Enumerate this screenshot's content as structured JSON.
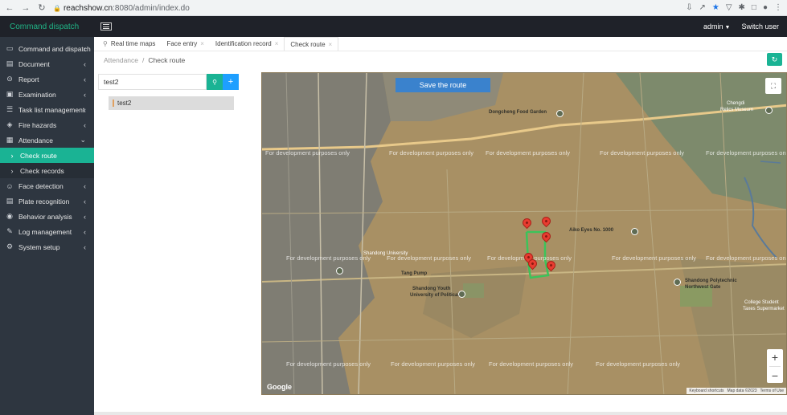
{
  "browser": {
    "url_host": "reachshow.cn",
    "url_path": ":8080/admin/index.do"
  },
  "header": {
    "brand": "Command dispatch",
    "user": "admin",
    "switch_user": "Switch user"
  },
  "sidebar": {
    "items": [
      {
        "label": "Command and dispatch",
        "icon": "monitor-icon"
      },
      {
        "label": "Document",
        "icon": "folder-icon"
      },
      {
        "label": "Report",
        "icon": "minus-circle-icon"
      },
      {
        "label": "Examination",
        "icon": "clipboard-icon"
      },
      {
        "label": "Task list management",
        "icon": "list-icon"
      },
      {
        "label": "Fire hazards",
        "icon": "fire-icon"
      },
      {
        "label": "Attendance",
        "icon": "calendar-icon"
      },
      {
        "label": "Check route",
        "icon": "chevron-right-icon"
      },
      {
        "label": "Check records",
        "icon": "chevron-right-icon"
      },
      {
        "label": "Face detection",
        "icon": "face-icon"
      },
      {
        "label": "Plate recognition",
        "icon": "card-icon"
      },
      {
        "label": "Behavior analysis",
        "icon": "eye-icon"
      },
      {
        "label": "Log management",
        "icon": "log-icon"
      },
      {
        "label": "System setup",
        "icon": "gear-icon"
      }
    ]
  },
  "tabs": [
    {
      "label": "Real time maps"
    },
    {
      "label": "Face entry"
    },
    {
      "label": "Identification record"
    },
    {
      "label": "Check route"
    }
  ],
  "breadcrumb": {
    "parent": "Attendance",
    "separator": "/",
    "current": "Check route"
  },
  "panel": {
    "search_value": "test2",
    "tree_item": "test2"
  },
  "map": {
    "save_button": "Save the route",
    "watermark": "For development purposes only",
    "google": "Google",
    "attribution": [
      "Keyboard shortcuts",
      "Map data ©2023",
      "Terms of Use"
    ],
    "places": {
      "dongcheng": "Dongcheng Food Garden",
      "chengdi": "Chengdi",
      "relics": "Relics Museum",
      "aiko": "Aiko Eyes No. 1000",
      "shandong_uni": "Shandong University",
      "shandong_youth": "Shandong Youth",
      "university_ps": "University of Political",
      "tang": "Tang Pump",
      "poly": "Shandong Polytechnic",
      "northwest": "Northwest Gate",
      "college_student": "College Student",
      "taxes": "Taxes Supermarket"
    },
    "route_color": "#3cc35a",
    "marker_color": "#e83c30"
  }
}
